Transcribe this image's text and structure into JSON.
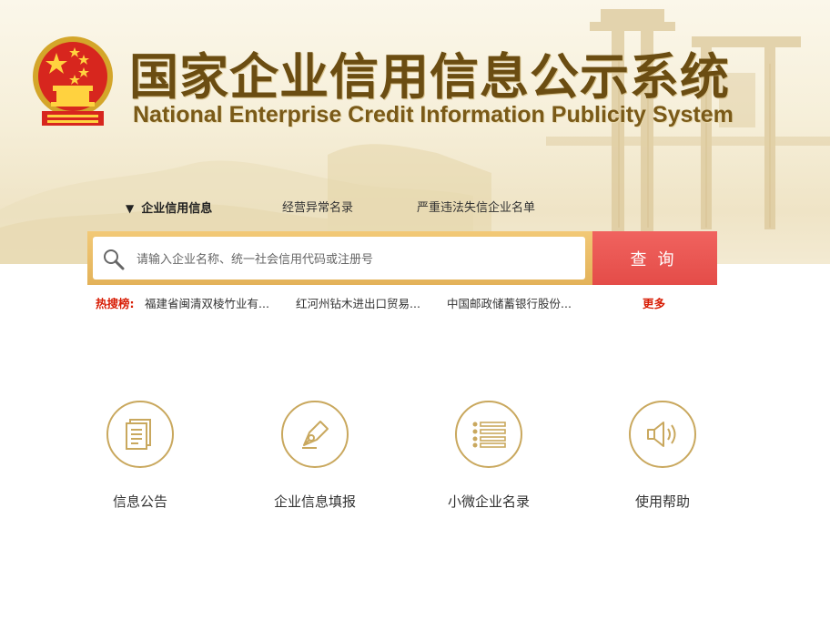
{
  "header": {
    "title_cn": "国家企业信用信息公示系统",
    "title_en": "National Enterprise Credit Information Publicity System",
    "emblem_icon": "national-emblem-icon"
  },
  "tabs": [
    {
      "label": "企业信用信息",
      "active": true
    },
    {
      "label": "经营异常名录",
      "active": false
    },
    {
      "label": "严重违法失信企业名单",
      "active": false
    }
  ],
  "search": {
    "placeholder": "请输入企业名称、统一社会信用代码或注册号",
    "value": "",
    "button_label": "查询",
    "icon": "search-icon"
  },
  "hot_search": {
    "label": "热搜榜:",
    "items": [
      "福建省闽清双棱竹业有...",
      "红河州钻木进出口贸易...",
      "中国邮政储蓄银行股份..."
    ],
    "more_label": "更多"
  },
  "features": [
    {
      "label": "信息公告",
      "icon": "document-icon"
    },
    {
      "label": "企业信息填报",
      "icon": "pen-icon"
    },
    {
      "label": "小微企业名录",
      "icon": "list-icon"
    },
    {
      "label": "使用帮助",
      "icon": "speaker-icon"
    }
  ],
  "colors": {
    "brand_gold": "#c9a85e",
    "title_brown": "#6b4d12",
    "search_red": "#e44c48",
    "hot_red": "#d81e06"
  }
}
